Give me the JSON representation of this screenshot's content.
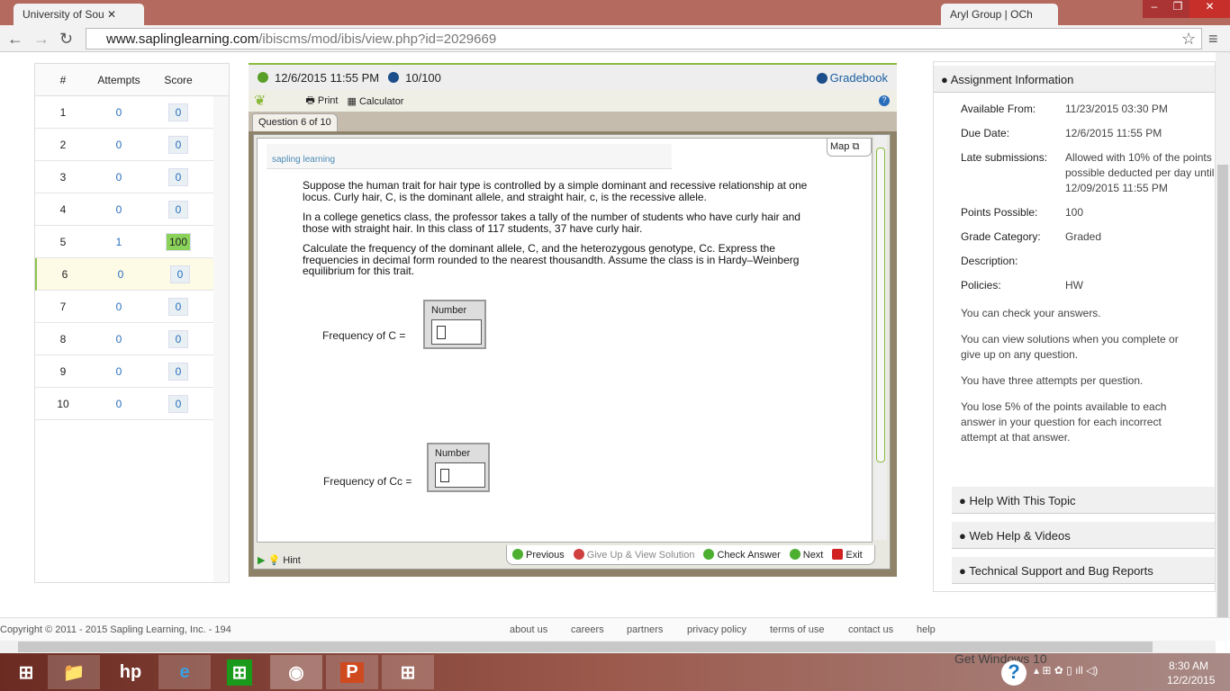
{
  "browser": {
    "tabs": [
      "University of Sou",
      "Aryl Group | OCh"
    ],
    "url_host": "www.saplinglearning.com",
    "url_path": "/ibiscms/mod/ibis/view.php?id=2029669"
  },
  "left": {
    "headers": [
      "#",
      "Attempts",
      "Score"
    ],
    "rows": [
      {
        "n": "1",
        "a": "0",
        "s": "0"
      },
      {
        "n": "2",
        "a": "0",
        "s": "0"
      },
      {
        "n": "3",
        "a": "0",
        "s": "0"
      },
      {
        "n": "4",
        "a": "0",
        "s": "0"
      },
      {
        "n": "5",
        "a": "1",
        "s": "100"
      },
      {
        "n": "6",
        "a": "0",
        "s": "0"
      },
      {
        "n": "7",
        "a": "0",
        "s": "0"
      },
      {
        "n": "8",
        "a": "0",
        "s": "0"
      },
      {
        "n": "9",
        "a": "0",
        "s": "0"
      },
      {
        "n": "10",
        "a": "0",
        "s": "0"
      }
    ],
    "current": 6
  },
  "center": {
    "due": "12/6/2015 11:55 PM",
    "grade": "10/100",
    "gradebook": "Gradebook",
    "print": "Print",
    "calculator": "Calculator",
    "question_tab": "Question 6 of 10",
    "map": "Map",
    "logo": "sapling learning",
    "paragraphs": [
      "Suppose the human trait for hair type is controlled by a simple dominant and recessive relationship at one locus. Curly hair, C, is the dominant allele, and straight hair, c, is the recessive allele.",
      "In a college genetics class, the professor takes a tally of the number of students who have curly hair and those with straight hair. In this class of 117 students, 37 have curly hair.",
      "Calculate the frequency of the dominant allele, C, and the heterozygous genotype, Cc. Express the frequencies in decimal form rounded to the nearest thousandth. Assume the class is in Hardy–Weinberg equilibrium for this trait."
    ],
    "answers": [
      {
        "label": "Frequency of C =",
        "box": "Number",
        "value": ""
      },
      {
        "label": "Frequency of Cc =",
        "box": "Number",
        "value": ""
      }
    ],
    "hint": "Hint",
    "nav": {
      "previous": "Previous",
      "giveup": "Give Up & View Solution",
      "check": "Check Answer",
      "next": "Next",
      "exit": "Exit"
    }
  },
  "right": {
    "title": "Assignment Information",
    "info": [
      {
        "k": "Available From:",
        "v": "11/23/2015 03:30 PM"
      },
      {
        "k": "Due Date:",
        "v": "12/6/2015 11:55 PM"
      },
      {
        "k": "Late submissions:",
        "v": "Allowed with 10% of the points possible deducted per day until 12/09/2015 11:55 PM"
      },
      {
        "k": "Points Possible:",
        "v": "100"
      },
      {
        "k": "Grade Category:",
        "v": "Graded"
      },
      {
        "k": "Description:",
        "v": ""
      },
      {
        "k": "Policies:",
        "v": "HW"
      }
    ],
    "notes": [
      "You can check your answers.",
      "You can view solutions when you complete or give up on any question.",
      "You have three attempts per question.",
      "You lose 5% of the points available to each answer in your question for each incorrect attempt at that answer."
    ],
    "sections": [
      "Help With This Topic",
      "Web Help & Videos",
      "Technical Support and Bug Reports"
    ]
  },
  "footer": {
    "copyright": "Copyright © 2011 - 2015 Sapling Learning, Inc. - 194",
    "links": [
      "about us",
      "careers",
      "partners",
      "privacy policy",
      "terms of use",
      "contact us",
      "help"
    ]
  },
  "taskbar": {
    "time": "8:30 AM",
    "date": "12/2/2015",
    "watermark": "Get Windows 10"
  }
}
